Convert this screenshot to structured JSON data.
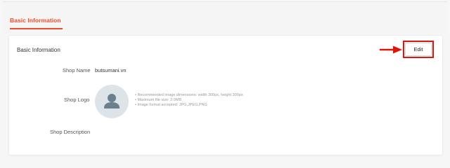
{
  "tabs": {
    "active_label": "Basic Information"
  },
  "card": {
    "title": "Basic Information",
    "edit_label": "Edit"
  },
  "fields": {
    "shop_name_label": "Shop Name",
    "shop_name_value": "butsumani.vn",
    "shop_logo_label": "Shop Logo",
    "shop_description_label": "Shop Description"
  },
  "logo_hints": [
    "• Recommended image dimensions: width 300px, height 300px",
    "• Maximum file size: 2.0MB",
    "• Image format accepted: JPG,JPEG,PNG"
  ],
  "colors": {
    "accent": "#ee4d2d",
    "highlight_red": "#e1140a",
    "avatar_bg": "#dde4e9",
    "avatar_icon": "#6b7f8c"
  },
  "icons": {
    "avatar": "user-silhouette-icon",
    "arrow": "arrow-right-icon"
  }
}
